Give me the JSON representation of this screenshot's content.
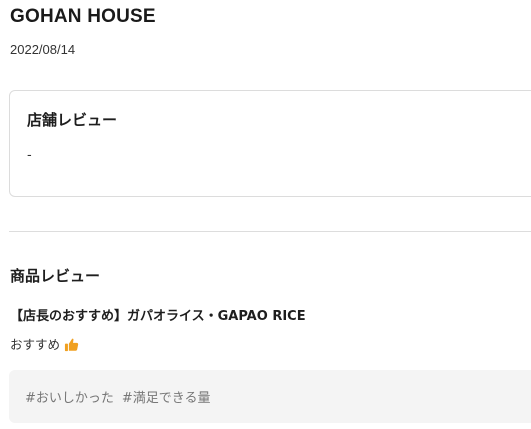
{
  "shop": {
    "name": "GOHAN HOUSE",
    "date": "2022/08/14"
  },
  "shop_review": {
    "title": "店舗レビュー",
    "body": "-"
  },
  "product_review": {
    "title": "商品レビュー",
    "product_name": "【店長のおすすめ】ガパオライス・GAPAO RICE",
    "recommend_label": "おすすめ",
    "recommend_icon": "thumbs-up-icon",
    "tags": [
      "#おいしかった",
      "#満足できる量"
    ]
  },
  "colors": {
    "accent_icon": "#f0a020",
    "tag_background": "#f4f4f4",
    "card_border": "#dcdcdc"
  }
}
